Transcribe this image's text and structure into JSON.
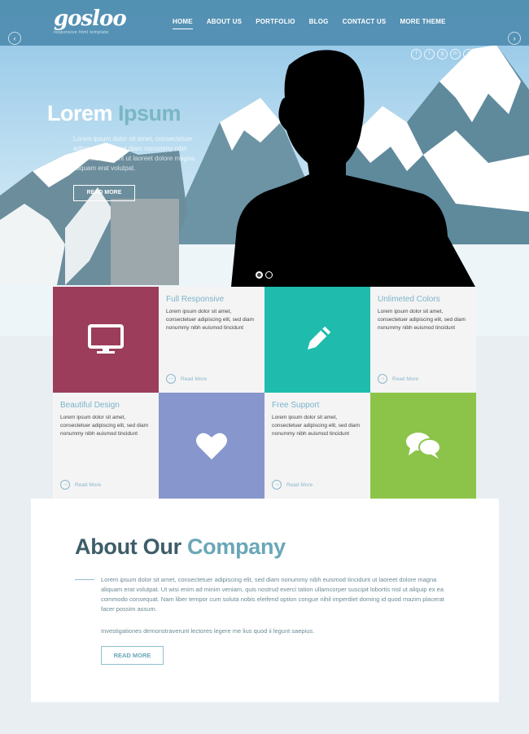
{
  "brand": {
    "logo": "gosloo",
    "tagline": "responsive html template"
  },
  "nav": {
    "items": [
      "HOME",
      "ABOUT US",
      "PORTFOLIO",
      "BLOG",
      "CONTACT US",
      "MORE THEME"
    ],
    "active": "HOME"
  },
  "slider": {
    "prev_icon": "chevron-left-icon",
    "next_icon": "chevron-right-icon",
    "active_dot": 1,
    "dot_count": 2
  },
  "social_icons": [
    "facebook-icon",
    "twitter-icon",
    "googleplus-icon",
    "linkedin-icon",
    "rss-icon"
  ],
  "hero": {
    "title_main": "Lorem",
    "title_accent": "Ipsum",
    "text": "Lorem ipsum dolor sit amet, consectetuer adipiscing elit, sed diam nonummy nibh euismod tincidunt ut laoreet dolore magna aliquam erat volutpat.",
    "button": "READ MORE"
  },
  "features": [
    {
      "title": "Full Responsive",
      "body": "Lorem ipsum dolor sit amet, consectetuer adipiscing elit, sed diam nonummy nibh euismod tincidunt",
      "link": "Read More",
      "icon": "monitor-icon",
      "color": "#9b3d5b"
    },
    {
      "title": "Unlimeted Colors",
      "body": "Lorem ipsum dolor sit amet, consectetuer adipiscing elit, sed diam nonummy nibh euismod tincidunt",
      "link": "Read More",
      "icon": "pencil-icon",
      "color": "#1fbcad"
    },
    {
      "title": "Beautiful Design",
      "body": "Lorem ipsum dolor sit amet, consectetuer adipiscing elit, sed diam nonummy nibh euismod tincidunt",
      "link": "Read More",
      "icon": "heart-icon",
      "color": "#8796cc"
    },
    {
      "title": "Free Support",
      "body": "Lorem ipsum dolor sit amet, consectetuer adipiscing elit, sed diam nonummy nibh euismod tincidunt",
      "link": "Read More",
      "icon": "chat-bubbles-icon",
      "color": "#8cc44a"
    }
  ],
  "about": {
    "title_main": "About Our",
    "title_accent": "Company",
    "paragraph1": "Lorem ipsum dolor sit amet, consectetuer adipiscing elit, sed diam nonummy nibh euismod tincidunt ut laoreet dolore magna aliquam erat volutpat. Ut wisi enim ad minim veniam, quis nostrud exerci tation ullamcorper suscipit lobortis nisl ut aliquip ex ea commodo consequat. Nam liber tempor cum soluta nobis eleifend option congue nihil imperdiet doming id quod mazim placerat facer possim assum.",
    "paragraph2": "Investigationes demonstraverunt lectores legere me lius quod ii legunt saepius.",
    "button": "READ MORE"
  }
}
